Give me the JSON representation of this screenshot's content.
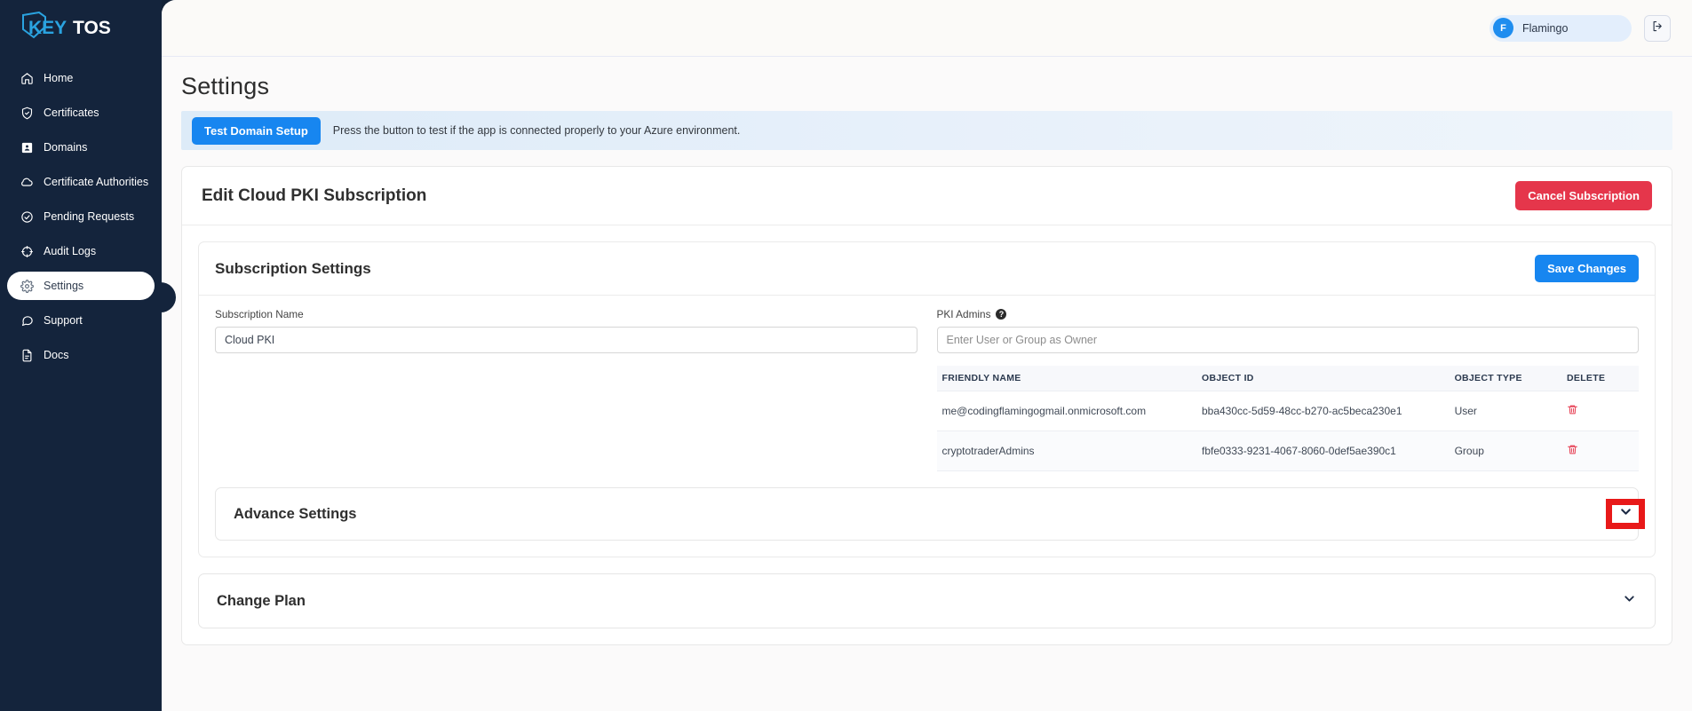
{
  "brand": {
    "name_key": "KEY",
    "name_tos": "TOS",
    "logo_alt": "Keytos logo"
  },
  "sidebar": {
    "items": [
      {
        "label": "Home",
        "icon": "home-icon",
        "active": false
      },
      {
        "label": "Certificates",
        "icon": "shield-check-icon",
        "active": false
      },
      {
        "label": "Domains",
        "icon": "id-card-icon",
        "active": false
      },
      {
        "label": "Certificate Authorities",
        "icon": "cloud-icon",
        "active": false
      },
      {
        "label": "Pending Requests",
        "icon": "check-circle-icon",
        "active": false
      },
      {
        "label": "Audit Logs",
        "icon": "crosshair-icon",
        "active": false
      },
      {
        "label": "Settings",
        "icon": "gear-icon",
        "active": true
      },
      {
        "label": "Support",
        "icon": "chat-bubble-icon",
        "active": false
      },
      {
        "label": "Docs",
        "icon": "document-icon",
        "active": false
      }
    ]
  },
  "topbar": {
    "user_initial": "F",
    "user_name": "Flamingo",
    "logout_icon": "logout-icon"
  },
  "page": {
    "title": "Settings"
  },
  "notice": {
    "button_label": "Test Domain Setup",
    "text": "Press the button to test if the app is connected properly to your Azure environment."
  },
  "subscription_card": {
    "title": "Edit Cloud PKI Subscription",
    "cancel_label": "Cancel Subscription"
  },
  "settings_section": {
    "title": "Subscription Settings",
    "save_label": "Save Changes",
    "subscription_name_label": "Subscription Name",
    "subscription_name_value": "Cloud PKI",
    "pki_admins_label": "PKI Admins",
    "pki_admins_help": "?",
    "pki_admins_placeholder": "Enter User or Group as Owner",
    "pki_admins_value": ""
  },
  "admins_table": {
    "columns": [
      "FRIENDLY NAME",
      "OBJECT ID",
      "OBJECT TYPE",
      "DELETE"
    ],
    "rows": [
      {
        "friendly_name": "me@codingflamingogmail.onmicrosoft.com",
        "object_id": "bba430cc-5d59-48cc-b270-ac5beca230e1",
        "object_type": "User",
        "delete_icon": "trash-icon"
      },
      {
        "friendly_name": "cryptotraderAdmins",
        "object_id": "fbfe0333-9231-4067-8060-0def5ae390c1",
        "object_type": "Group",
        "delete_icon": "trash-icon"
      }
    ]
  },
  "advance_settings": {
    "title": "Advance Settings",
    "chevron": "chevron-down-icon",
    "highlighted": true
  },
  "change_plan": {
    "title": "Change Plan",
    "chevron": "chevron-down-icon",
    "highlighted": false
  },
  "colors": {
    "sidebar_bg": "#14243c",
    "accent_blue": "#1786f0",
    "danger_red": "#e5364b",
    "highlight_red": "#e81919",
    "logo_blue": "#2aa3e0",
    "page_bg": "#fbfafa"
  }
}
